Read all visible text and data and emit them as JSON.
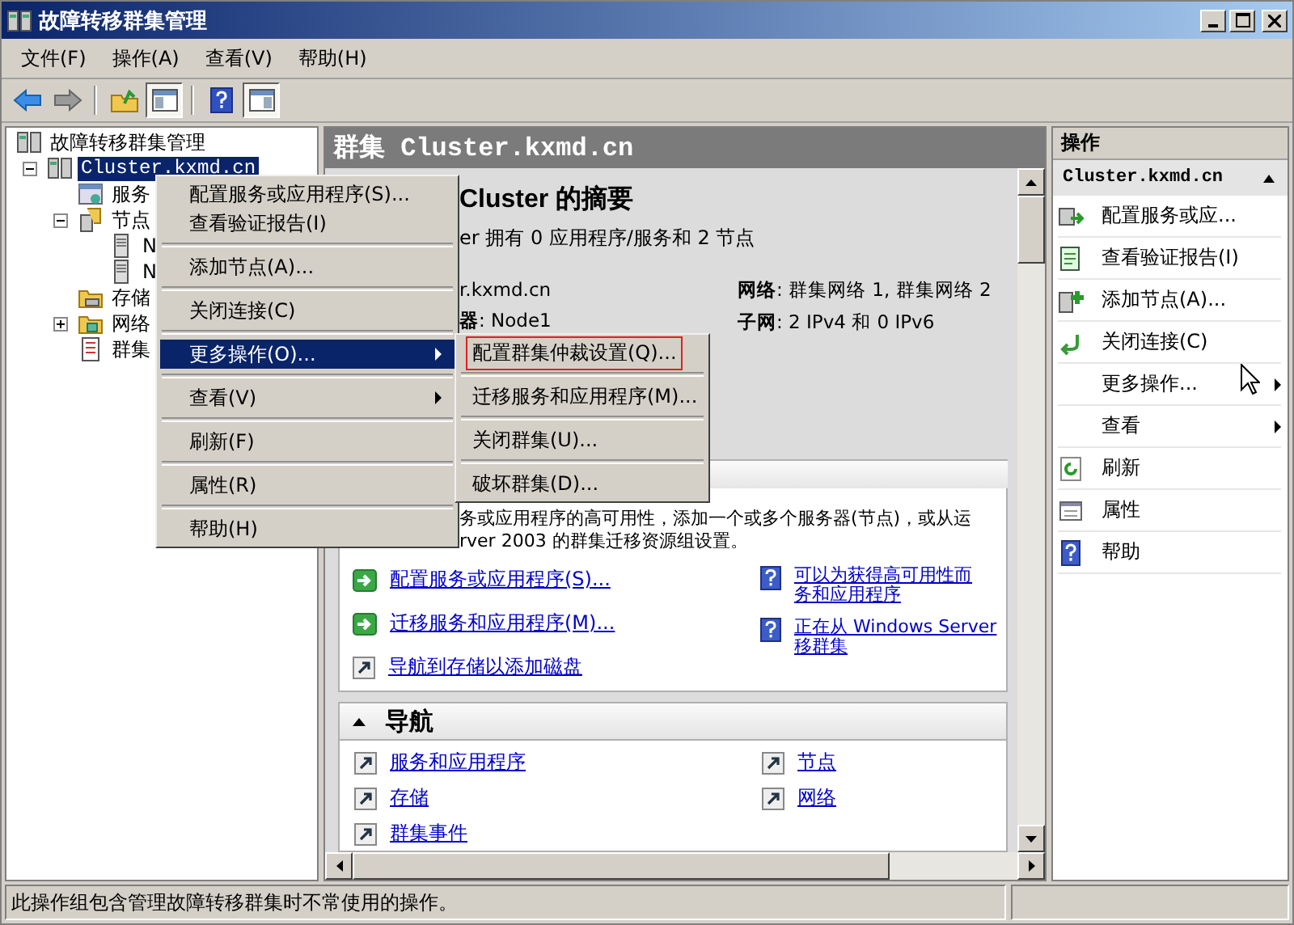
{
  "window": {
    "title": "故障转移群集管理"
  },
  "menu_bar": [
    "文件(F)",
    "操作(A)",
    "查看(V)",
    "帮助(H)"
  ],
  "toolbar": [
    {
      "kind": "back",
      "pressed": false
    },
    {
      "kind": "forward",
      "pressed": false
    },
    {
      "kind": "separator"
    },
    {
      "kind": "up-folder",
      "pressed": false
    },
    {
      "kind": "tree-pane",
      "pressed": true
    },
    {
      "kind": "separator"
    },
    {
      "kind": "help",
      "pressed": false
    },
    {
      "kind": "action-pane",
      "pressed": true
    }
  ],
  "tree": {
    "items": [
      {
        "label": "故障转移群集管理",
        "kind": "cluster",
        "selected": false,
        "children": [
          {
            "label": "Cluster.kxmd.cn",
            "kind": "cluster",
            "selected": true,
            "expanded": true,
            "children": [
              {
                "label": "服务",
                "kind": "services",
                "selected": false
              },
              {
                "label": "节点",
                "kind": "nodes",
                "selected": false,
                "expanded": true,
                "children": [
                  {
                    "label": "N",
                    "kind": "server",
                    "selected": false
                  },
                  {
                    "label": "N",
                    "kind": "server",
                    "selected": false
                  }
                ]
              },
              {
                "label": "存储",
                "kind": "storage",
                "selected": false
              },
              {
                "label": "网络",
                "kind": "network",
                "selected": false,
                "expanded": false
              },
              {
                "label": "群集",
                "kind": "events",
                "selected": false
              }
            ]
          }
        ]
      }
    ]
  },
  "center": {
    "header": "群集 Cluster.kxmd.cn",
    "summary": {
      "title": "Cluster 的摘要",
      "subtitle": "er 拥有 0 应用程序/服务和 2 节点",
      "left": [
        "r.kxmd.cn",
        "**器**: Node1"
      ],
      "right": [
        "**网络**: 群集网络 1, 群集网络 2",
        "**子网**: 2 IPv4 和 0 IPv6"
      ]
    },
    "configure": {
      "text_lines": [
        "务或应用程序的高可用性，添加一个或多个服务器(节点)，或从运",
        "rver 2003 的群集迁移资源组设置。"
      ],
      "actions": [
        {
          "kind": "green-arrow",
          "label": "配置服务或应用程序(S)..."
        },
        {
          "kind": "green-arrow",
          "label": "迁移服务和应用程序(M)..."
        },
        {
          "kind": "shortcut",
          "label": "导航到存储以添加磁盘"
        }
      ],
      "help_links": [
        {
          "lines": [
            "可以为获得高可用性而",
            "务和应用程序"
          ]
        },
        {
          "lines": [
            "正在从 Windows Server",
            "移群集"
          ]
        }
      ]
    },
    "navigation": {
      "title": "导航",
      "expanded": true,
      "links": [
        "服务和应用程序",
        "节点",
        "存储",
        "网络",
        "群集事件"
      ]
    }
  },
  "actions_pane": {
    "title": "操作",
    "group": {
      "title": "Cluster.kxmd.cn",
      "expanded": true
    },
    "items": [
      {
        "kind": "configure",
        "label": "配置服务或应...",
        "submenu": false
      },
      {
        "kind": "report",
        "label": "查看验证报告(I)",
        "submenu": false
      },
      {
        "kind": "add-node",
        "label": "添加节点(A)...",
        "submenu": false
      },
      {
        "kind": "close-connection",
        "label": "关闭连接(C)",
        "submenu": false
      },
      {
        "kind": "none",
        "label": "更多操作...",
        "submenu": true
      },
      {
        "kind": "none",
        "label": "查看",
        "submenu": true
      },
      {
        "kind": "refresh",
        "label": "刷新",
        "submenu": false
      },
      {
        "kind": "properties",
        "label": "属性",
        "submenu": false
      },
      {
        "kind": "help",
        "label": "帮助",
        "submenu": false
      }
    ]
  },
  "context_menu": {
    "groups": [
      [
        {
          "label": "配置服务或应用程序(S)...",
          "submenu": false,
          "selected": false
        },
        {
          "label": "查看验证报告(I)",
          "submenu": false,
          "selected": false
        }
      ],
      [
        {
          "label": "添加节点(A)...",
          "submenu": false,
          "selected": false
        }
      ],
      [
        {
          "label": "关闭连接(C)",
          "submenu": false,
          "selected": false
        }
      ],
      [
        {
          "label": "更多操作(O)...",
          "submenu": true,
          "selected": true
        }
      ],
      [
        {
          "label": "查看(V)",
          "submenu": true,
          "selected": false
        }
      ],
      [
        {
          "label": "刷新(F)",
          "submenu": false,
          "selected": false
        }
      ],
      [
        {
          "label": "属性(R)",
          "submenu": false,
          "selected": false
        }
      ],
      [
        {
          "label": "帮助(H)",
          "submenu": false,
          "selected": false
        }
      ]
    ],
    "submenu": {
      "items": [
        {
          "label": "配置群集仲裁设置(Q)...",
          "outlined": true
        },
        {
          "label": "迁移服务和应用程序(M)...",
          "outlined": false
        },
        {
          "label": "关闭群集(U)...",
          "outlined": false
        },
        {
          "label": "破坏群集(D)...",
          "outlined": false
        }
      ]
    }
  },
  "status_bar": {
    "text": "此操作组包含管理故障转移群集时不常使用的操作。"
  }
}
